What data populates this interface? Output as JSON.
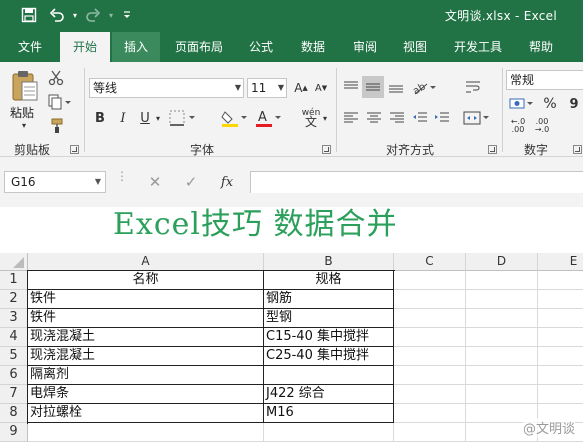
{
  "titlebar": {
    "title": "文明谈.xlsx  -  Excel",
    "bg_color": "#217346",
    "qat": [
      {
        "name": "save-icon",
        "glyph": "💾"
      },
      {
        "name": "undo-icon",
        "glyph": "↶"
      },
      {
        "name": "redo-icon",
        "glyph": "↷"
      },
      {
        "name": "customize-qat-icon",
        "glyph": "▾"
      }
    ]
  },
  "tabs": [
    "文件",
    "开始",
    "插入",
    "页面布局",
    "公式",
    "数据",
    "审阅",
    "视图",
    "开发工具",
    "帮助"
  ],
  "active_tab": "开始",
  "ribbon": {
    "clipboard": {
      "paste_label": "粘贴",
      "group_label": "剪贴板"
    },
    "font": {
      "font_name": "等线",
      "font_size": "11",
      "group_label": "字体",
      "bold": "B",
      "italic": "I",
      "underline": "U",
      "phonetic": "wén"
    },
    "alignment": {
      "group_label": "对齐方式"
    },
    "number": {
      "format": "常规",
      "group_label": "数字",
      "percent": "%"
    }
  },
  "formula_bar": {
    "name_box": "G16",
    "fx_label": "fx",
    "formula": ""
  },
  "sheet": {
    "banner": "Excel技巧 数据合并",
    "banner_color": "#2aa05a",
    "columns": [
      "A",
      "B",
      "C",
      "D",
      "E"
    ],
    "rows": [
      "1",
      "2",
      "3",
      "4",
      "5",
      "6",
      "7",
      "8",
      "9"
    ],
    "cells": [
      [
        "名称",
        "规格"
      ],
      [
        "铁件",
        "钢筋"
      ],
      [
        "铁件",
        "型钢"
      ],
      [
        "现浇混凝土",
        "C15-40 集中搅拌"
      ],
      [
        "现浇混凝土",
        "C25-40 集中搅拌"
      ],
      [
        "隔离剂",
        ""
      ],
      [
        "电焊条",
        "J422 综合"
      ],
      [
        "对拉螺栓",
        "M16"
      ],
      [
        "",
        ""
      ]
    ]
  },
  "watermark": "@文明谈"
}
